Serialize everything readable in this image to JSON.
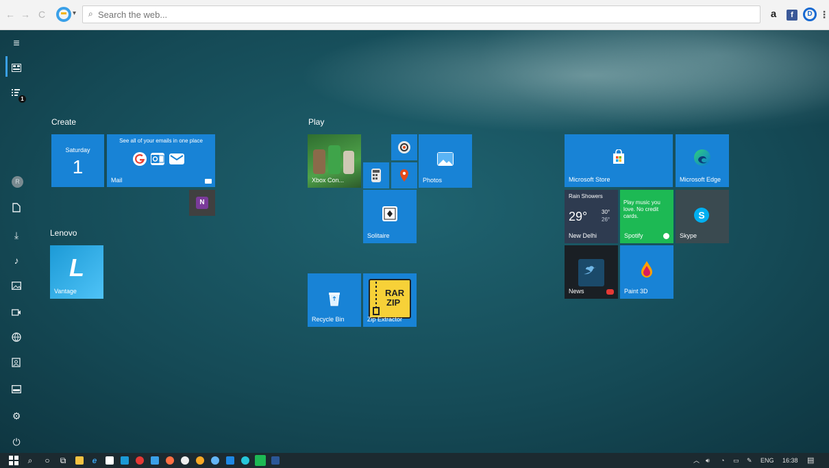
{
  "browser": {
    "back": "←",
    "forward": "→",
    "refresh": "C",
    "search_placeholder": "Search the web...",
    "ext_amazon": "a",
    "ext_facebook": "f",
    "ext_d": "D",
    "menu": "⋮"
  },
  "rail": {
    "tasks_badge": "1",
    "avatar_glyph": "R"
  },
  "groups": {
    "create": "Create",
    "play": "Play",
    "lenovo": "Lenovo"
  },
  "tiles": {
    "calendar_day": "Saturday",
    "calendar_date": "1",
    "mail_title": "See all of your emails in one place",
    "mail_label": "Mail",
    "vantage_glyph": "L",
    "vantage_label": "Vantage",
    "xbox_label": "Xbox Con...",
    "photos_label": "Photos",
    "solitaire_label": "Solitaire",
    "recycle_label": "Recycle Bin",
    "zip_label": "Zip Extractor",
    "zip_text_1": "RAR",
    "zip_text_2": "ZIP",
    "store_label": "Microsoft Store",
    "edge_label": "Microsoft Edge",
    "weather_condition": "Rain Showers",
    "weather_temp": "29°",
    "weather_high": "30°",
    "weather_low": "26°",
    "weather_city": "New Delhi",
    "spotify_text": "Play music you love. No credit cards.",
    "spotify_label": "Spotify",
    "skype_glyph": "S",
    "skype_label": "Skype",
    "news_label": "News",
    "paint3d_label": "Paint 3D",
    "onenote_glyph": "N"
  },
  "taskbar": {
    "language": "ENG",
    "time": "16:38"
  },
  "colors": {
    "tile_blue": "#1883d6",
    "spotify_green": "#1db954",
    "skype_gray": "#3a4a50",
    "onenote_purple": "#7a3b9a",
    "zip_yellow": "#f7d138"
  }
}
